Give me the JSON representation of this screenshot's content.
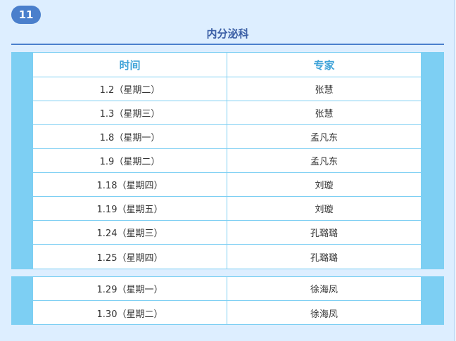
{
  "badge": "11",
  "section_title": "内分泌科",
  "table": {
    "headers": [
      "时间",
      "专家"
    ],
    "rows_block1": [
      [
        "1.2（星期二）",
        "张慧"
      ],
      [
        "1.3（星期三）",
        "张慧"
      ],
      [
        "1.8（星期一）",
        "孟凡东"
      ],
      [
        "1.9（星期二）",
        "孟凡东"
      ],
      [
        "1.18（星期四）",
        "刘璇"
      ],
      [
        "1.19（星期五）",
        "刘璇"
      ],
      [
        "1.24（星期三）",
        "孔璐璐"
      ],
      [
        "1.25（星期四）",
        "孔璐璐"
      ]
    ],
    "rows_block2": [
      [
        "1.29（星期一）",
        "徐海凤"
      ],
      [
        "1.30（星期二）",
        "徐海凤"
      ]
    ]
  },
  "colors": {
    "background": "#ddeeff",
    "accent": "#4a7fcc",
    "table_border": "#7dcff3",
    "header_text": "#3fa3d8"
  }
}
